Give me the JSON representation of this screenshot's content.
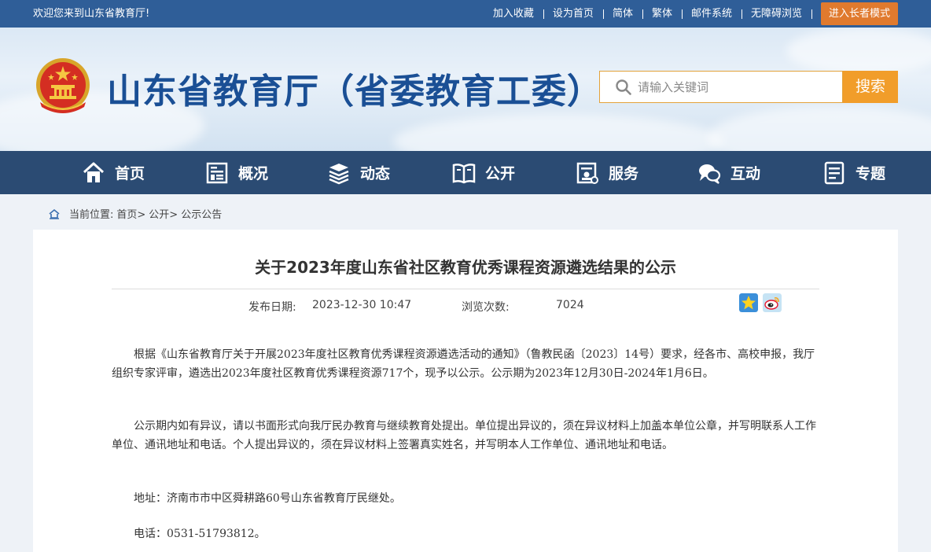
{
  "topbar": {
    "welcome": "欢迎您来到山东省教育厅!",
    "links": [
      "加入收藏",
      "设为首页",
      "简体",
      "繁体",
      "邮件系统",
      "无障碍浏览"
    ],
    "elder_mode": "进入长者模式"
  },
  "header": {
    "site_title": "山东省教育厅（省委教育工委）",
    "search_placeholder": "请输入关键词",
    "search_button": "搜索"
  },
  "nav": {
    "items": [
      {
        "label": "首页",
        "icon": "home-icon"
      },
      {
        "label": "概况",
        "icon": "building-icon"
      },
      {
        "label": "动态",
        "icon": "layers-icon"
      },
      {
        "label": "公开",
        "icon": "book-icon"
      },
      {
        "label": "服务",
        "icon": "service-icon"
      },
      {
        "label": "互动",
        "icon": "chat-icon"
      },
      {
        "label": "专题",
        "icon": "document-icon"
      }
    ]
  },
  "breadcrumb": {
    "prefix": "当前位置:",
    "items": [
      "首页>",
      "公开>",
      "公示公告"
    ]
  },
  "article": {
    "title": "关于2023年度山东省社区教育优秀课程资源遴选结果的公示",
    "publish_label": "发布日期:",
    "publish_date": "2023-12-30 10:47",
    "views_label": "浏览次数:",
    "views": "7024",
    "paragraphs": [
      "根据《山东省教育厅关于开展2023年度社区教育优秀课程资源遴选活动的通知》（鲁教民函〔2023〕14号）要求，经各市、高校申报，我厅组织专家评审，遴选出2023年度社区教育优秀课程资源717个，现予以公示。公示期为2023年12月30日-2024年1月6日。",
      "公示期内如有异议，请以书面形式向我厅民办教育与继续教育处提出。单位提出异议的，须在异议材料上加盖本单位公章，并写明联系人工作单位、通讯地址和电话。个人提出异议的，须在异议材料上签署真实姓名，并写明本人工作单位、通讯地址和电话。",
      "地址：济南市市中区舜耕路60号山东省教育厅民继处。",
      "电话：0531-51793812。"
    ]
  },
  "colors": {
    "topbar": "#2f5e98",
    "nav": "#2b4b73",
    "title": "#1a4f95",
    "accent": "#f19d2a"
  }
}
